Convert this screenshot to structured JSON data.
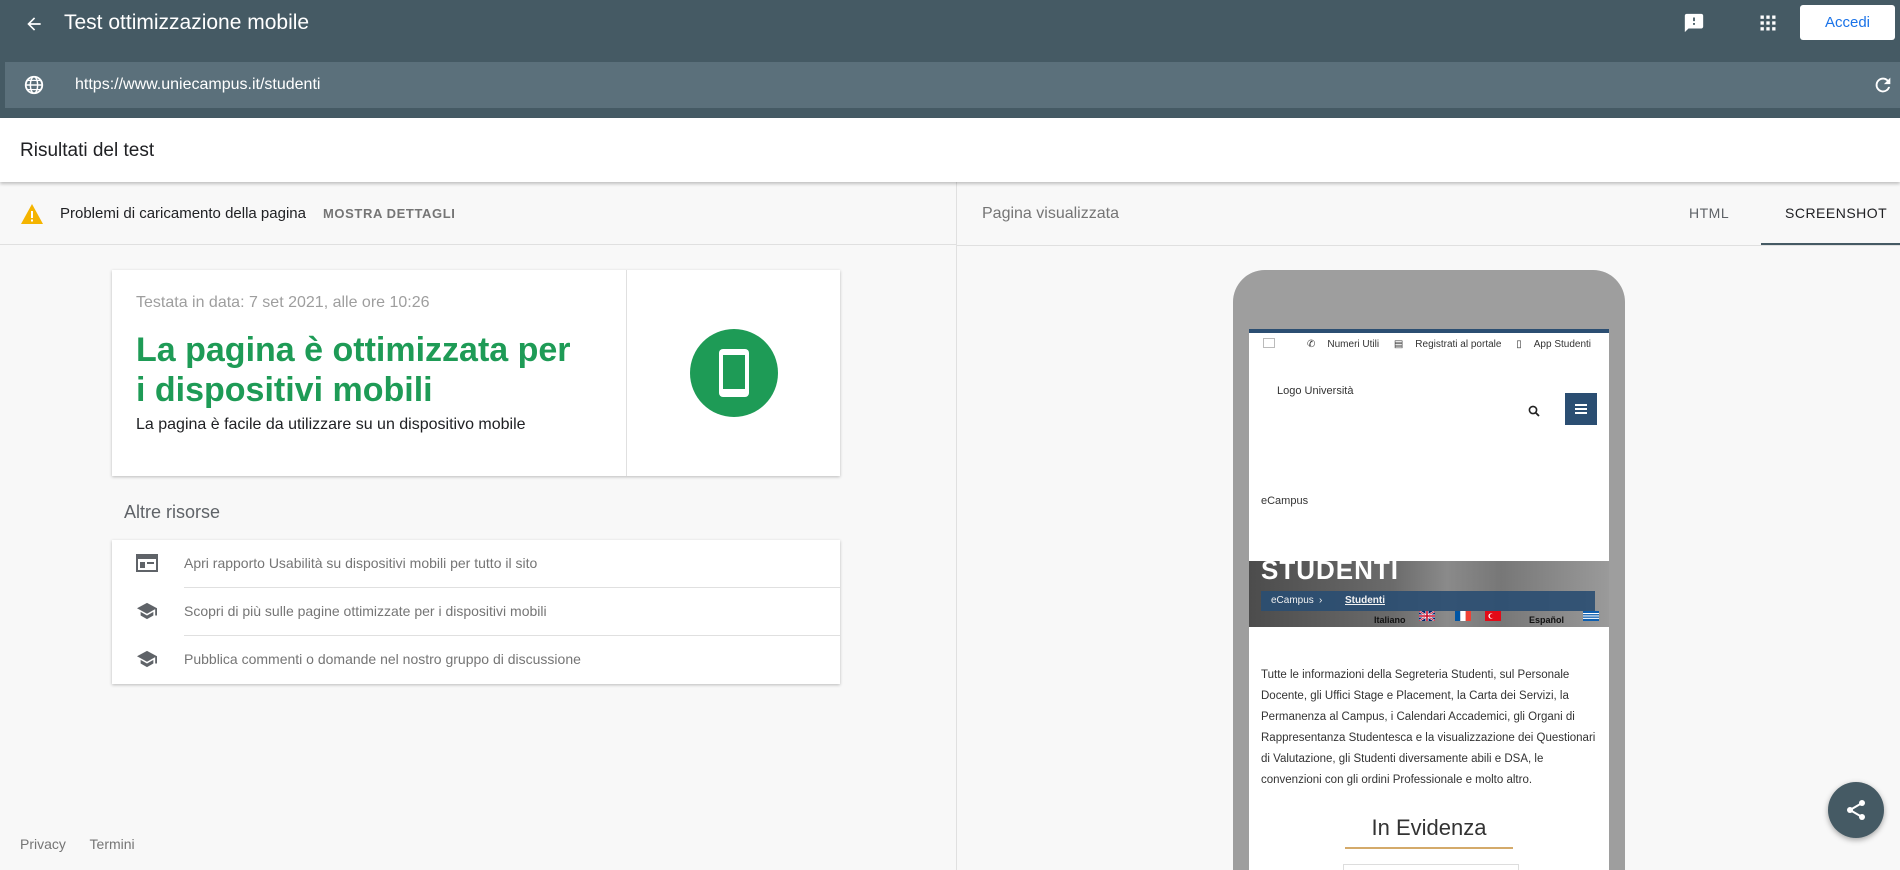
{
  "header": {
    "title": "Test ottimizzazione mobile",
    "signin_label": "Accedi"
  },
  "urlbar": {
    "url": "https://www.uniecampus.it/studenti"
  },
  "results": {
    "title": "Risultati del test"
  },
  "issues": {
    "text": "Problemi di caricamento della pagina",
    "details_link": "MOSTRA DETTAGLI"
  },
  "result_card": {
    "date": "Testata in data: 7 set 2021, alle ore 10:26",
    "heading": "La pagina è ottimizzata per i dispositivi mobili",
    "subtitle": "La pagina è facile da utilizzare su un dispositivo mobile",
    "accent_color": "#1e9b56"
  },
  "resources": {
    "title": "Altre risorse",
    "items": [
      {
        "label": "Apri rapporto Usabilità su dispositivi mobili per tutto il sito",
        "icon": "web-layout-icon"
      },
      {
        "label": "Scopri di più sulle pagine ottimizzate per i dispositivi mobili",
        "icon": "school-icon"
      },
      {
        "label": "Pubblica commenti o domande nel nostro gruppo di discussione",
        "icon": "school-icon"
      }
    ]
  },
  "footer": {
    "privacy": "Privacy",
    "terms": "Termini"
  },
  "preview": {
    "label": "Pagina visualizzata",
    "tabs": [
      {
        "label": "HTML",
        "selected": false
      },
      {
        "label": "SCREENSHOT",
        "selected": true
      }
    ]
  },
  "screenshot": {
    "top_links": [
      "Numeri Utili",
      "Registrati al portale",
      "App Studenti"
    ],
    "logo_text": "Logo Università",
    "brand_text": "eCampus",
    "hero_title": "STUDENTI",
    "breadcrumb_home": "eCampus",
    "breadcrumb_sep": "›",
    "breadcrumb_current": "Studenti",
    "lang_italiano": "Italiano",
    "lang_espanol": "Español",
    "description": "Tutte le informazioni della Segreteria Studenti, sul Personale Docente, gli Uffici Stage e Placement, la Carta dei Servizi, la Permanenza al Campus, i Calendari Accademici, gli Organi di Rappresentanza Studentesca e la visualizzazione dei Questionari di Valutazione, gli Studenti diversamente abili e DSA, le convenzioni con gli ordini Professionale e molto altro.",
    "evidence_title": "In Evidenza"
  },
  "colors": {
    "header_bg": "#455a64",
    "urlbar_bg": "#5b707b",
    "success_green": "#1e9b56",
    "warning_amber": "#f4b400",
    "link_blue": "#1a73e8"
  }
}
